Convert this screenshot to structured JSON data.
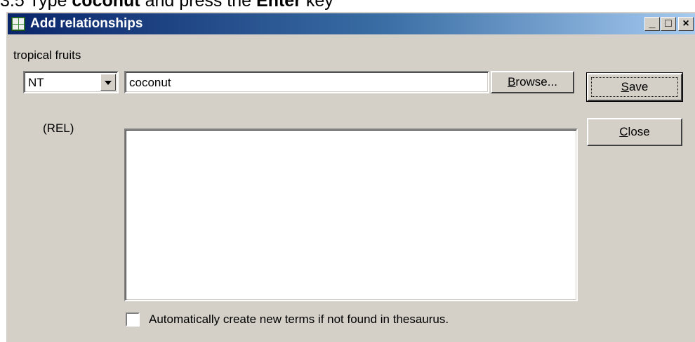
{
  "caption": {
    "prefix": "3.5 Type ",
    "bold1": "coconut",
    "middle": " and press the ",
    "bold2": "Enter",
    "suffix": " key"
  },
  "window": {
    "title": "Add relationships"
  },
  "titlebar": {
    "minimize": "_",
    "maximize": "□",
    "close": "×"
  },
  "form": {
    "term_label": "tropical fruits",
    "relation_type": "NT",
    "term_value": "coconut",
    "rel_label": "(REL)",
    "auto_create_label": "Automatically create new terms if not found in thesaurus.",
    "auto_create_checked": false
  },
  "buttons": {
    "browse_prefix": "",
    "browse_key": "B",
    "browse_rest": "rowse...",
    "save_key": "S",
    "save_rest": "ave",
    "close_key": "C",
    "close_rest": "lose"
  },
  "icons": {
    "app": "thesaurus-app-icon",
    "dropdown": "chevron-down-icon"
  }
}
